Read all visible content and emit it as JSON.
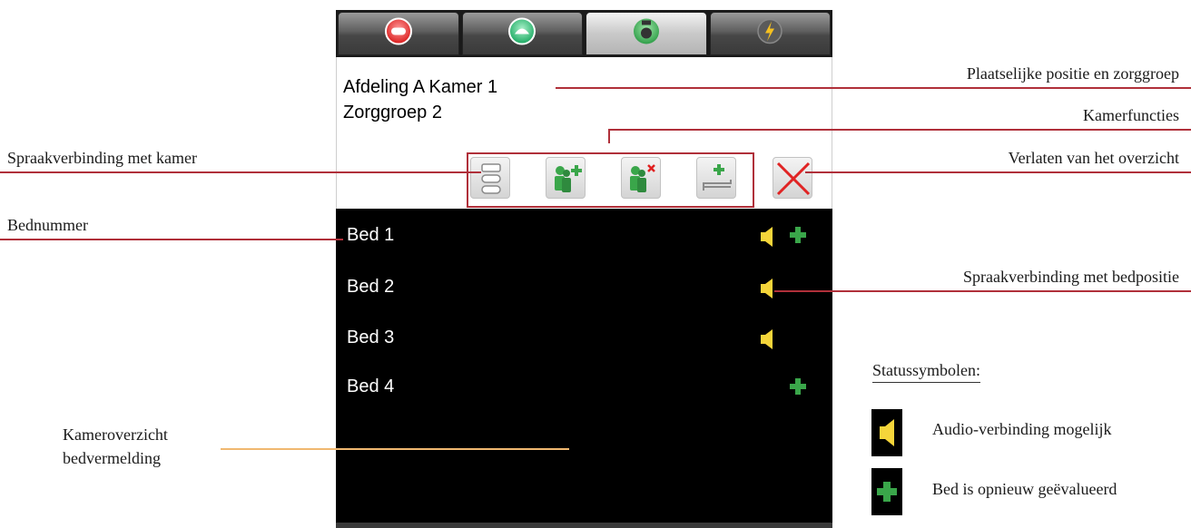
{
  "header": {
    "location": "Afdeling A Kamer 1",
    "care_group": "Zorggroep 2"
  },
  "tabs": [
    {
      "icon": "red-alarm-icon",
      "active": false
    },
    {
      "icon": "green-presence-icon",
      "active": false
    },
    {
      "icon": "room-overview-icon",
      "active": true
    },
    {
      "icon": "lightning-icon",
      "active": false
    }
  ],
  "room_functions": [
    {
      "icon": "intercom-icon"
    },
    {
      "icon": "person-add-icon"
    },
    {
      "icon": "person-remove-icon"
    },
    {
      "icon": "bed-add-icon"
    },
    {
      "icon": "close-icon"
    }
  ],
  "beds": [
    {
      "label": "Bed 1",
      "audio": true,
      "reassessed": true
    },
    {
      "label": "Bed 2",
      "audio": true,
      "reassessed": false
    },
    {
      "label": "Bed 3",
      "audio": true,
      "reassessed": false
    },
    {
      "label": "Bed 4",
      "audio": false,
      "reassessed": true
    }
  ],
  "annotations": {
    "location_group": "Plaatselijke positie en zorggroep",
    "room_functions": "Kamerfuncties",
    "room_intercom": "Spraakverbinding met kamer",
    "leave_overview": "Verlaten van het overzicht",
    "bed_number": "Bednummer",
    "bed_intercom": "Spraakverbinding met bedpositie",
    "overview_line1": "Kameroverzicht",
    "overview_line2": "bedvermelding"
  },
  "legend": {
    "title": "Statussymbolen:",
    "audio": "Audio-verbinding mogelijk",
    "reassessed": "Bed is opnieuw geëvalueerd"
  },
  "colors": {
    "annotation_line": "#b0303a",
    "overview_line": "#f0b870",
    "speaker": "#f5d53a",
    "plus": "#3aa64a"
  }
}
